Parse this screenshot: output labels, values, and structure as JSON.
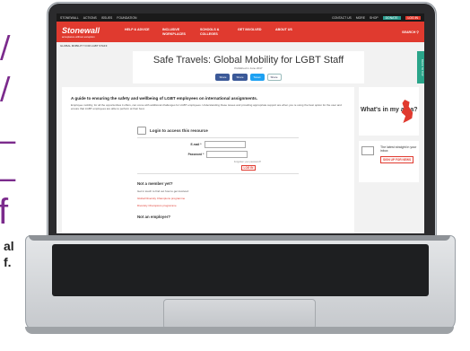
{
  "topbar": {
    "items": [
      "STONEWALL",
      "ACTIONS",
      "ISSUES",
      "FOUNDATION",
      "STONEWALL..."
    ],
    "right": "CONTACT US",
    "more": "MORE",
    "shop": "SHOP",
    "donate": "DONATE",
    "login": "LOG IN"
  },
  "header": {
    "logo": "Stonewall",
    "tagline": "acceptance without exception",
    "nav": [
      "HELP & ADVICE",
      "INCLUSIVE WORKPLACES",
      "SCHOOLS & COLLEGES",
      "GET INVOLVED",
      "ABOUT US"
    ],
    "search": "SEARCH"
  },
  "breadcrumb": "GLOBAL MOBILITY FOR LGBT STAFF",
  "hero": {
    "title": "Safe Travels: Global Mobility for LGBT Staff",
    "published": "Published in June 2017",
    "share": [
      "Share",
      "Share",
      "Tweet",
      "Share"
    ]
  },
  "main": {
    "heading": "A guide to ensuring the safety and wellbeing of LGBT employees on international assignments.",
    "intro": "Employee mobility, for all the opportunities it offers, can come with additional challenges for LGBT employees. Understanding these issues and providing appropriate support are when you re using the best option for the user and ensure that LGBT employees are able to perform at their best.",
    "login_title": "Login to access this resource",
    "email_label": "E-mail *",
    "password_label": "Password *",
    "forgot": "Forgotten your password?",
    "login_button": "LOG IN",
    "not_member": "Not a member yet?",
    "get_in_touch": "Get in touch to find out how to get involved:",
    "links": [
      "Global Diversity Champions programme",
      "Diversity Champions programme"
    ],
    "not_employer": "Not an employer?"
  },
  "sidebar": {
    "area_title": "What's in my area?",
    "inbox_text": "The latest straight in your inbox",
    "signup": "SIGN UP FOR NEWS"
  },
  "side_tab": "BACK TO TOP",
  "left_margin": {
    "caption_lines": [
      "al",
      "f."
    ],
    "glyph": "f"
  }
}
